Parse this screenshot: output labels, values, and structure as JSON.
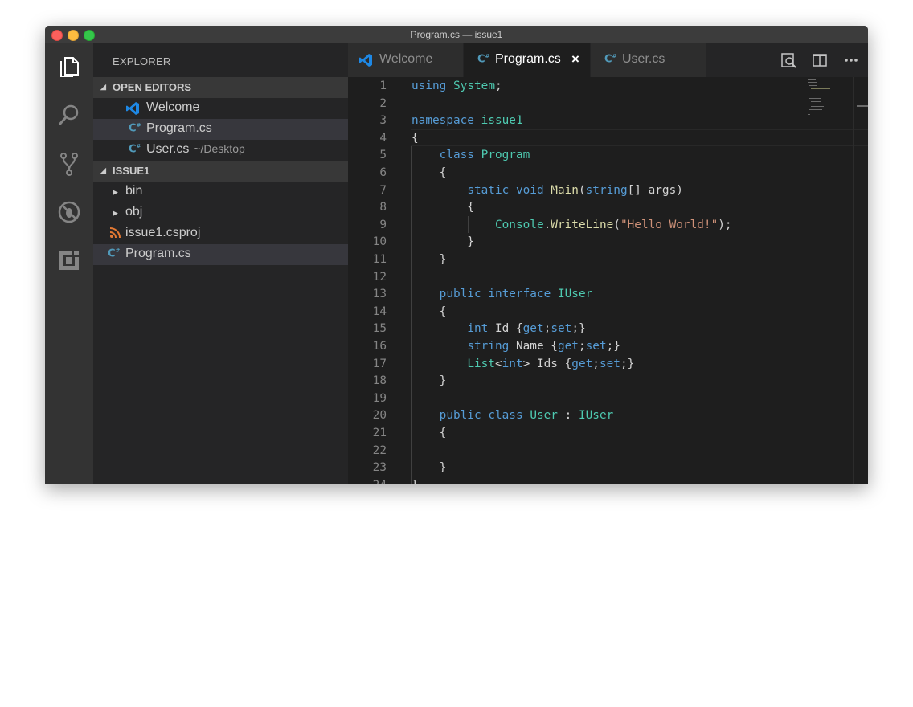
{
  "window": {
    "title": "Program.cs — issue1"
  },
  "activity_bar": {
    "items": [
      {
        "icon": "files-icon",
        "label": "Explorer"
      },
      {
        "icon": "search-icon",
        "label": "Search"
      },
      {
        "icon": "source-control-icon",
        "label": "Source Control"
      },
      {
        "icon": "debug-icon",
        "label": "Debug"
      },
      {
        "icon": "extensions-icon",
        "label": "Extensions"
      }
    ]
  },
  "sidebar": {
    "title": "EXPLORER",
    "open_editors": {
      "label": "OPEN EDITORS",
      "items": [
        {
          "name": "Welcome",
          "icon": "vscode-icon",
          "description": ""
        },
        {
          "name": "Program.cs",
          "icon": "csharp-icon",
          "description": "",
          "selected": true
        },
        {
          "name": "User.cs",
          "icon": "csharp-icon",
          "description": "~/Desktop"
        }
      ]
    },
    "folder": {
      "label": "ISSUE1",
      "items": [
        {
          "name": "bin",
          "type": "folder",
          "icon": "chevron-right-icon"
        },
        {
          "name": "obj",
          "type": "folder",
          "icon": "chevron-right-icon"
        },
        {
          "name": "issue1.csproj",
          "type": "file",
          "icon": "rss-icon"
        },
        {
          "name": "Program.cs",
          "type": "file",
          "icon": "csharp-icon",
          "selected": true
        }
      ]
    }
  },
  "tabs": [
    {
      "label": "Welcome",
      "icon": "vscode-icon",
      "active": false
    },
    {
      "label": "Program.cs",
      "icon": "csharp-icon",
      "active": true,
      "close": "×"
    },
    {
      "label": "User.cs",
      "icon": "csharp-icon",
      "active": false
    }
  ],
  "editor_actions": [
    "open-preview-icon",
    "split-editor-icon",
    "more-actions-icon"
  ],
  "code": {
    "lines": [
      "using System;",
      "",
      "namespace issue1",
      "{",
      "    class Program",
      "    {",
      "        static void Main(string[] args)",
      "        {",
      "            Console.WriteLine(\"Hello World!\");",
      "        }",
      "    }",
      "",
      "    public interface IUser",
      "    {",
      "        int Id {get;set;}",
      "        string Name {get;set;}",
      "        List<int> Ids {get;set;}",
      "    }",
      "",
      "    public class User : IUser",
      "    {",
      "",
      "    }",
      "}"
    ],
    "cursor_line": 4
  },
  "colors": {
    "keyword": "#569cd6",
    "type": "#4ec9b0",
    "function": "#dcdcaa",
    "string": "#ce9178",
    "text": "#d4d4d4",
    "line_number": "#858585",
    "editor_bg": "#1e1e1e",
    "sidebar_bg": "#252526",
    "activity_bg": "#333333"
  }
}
